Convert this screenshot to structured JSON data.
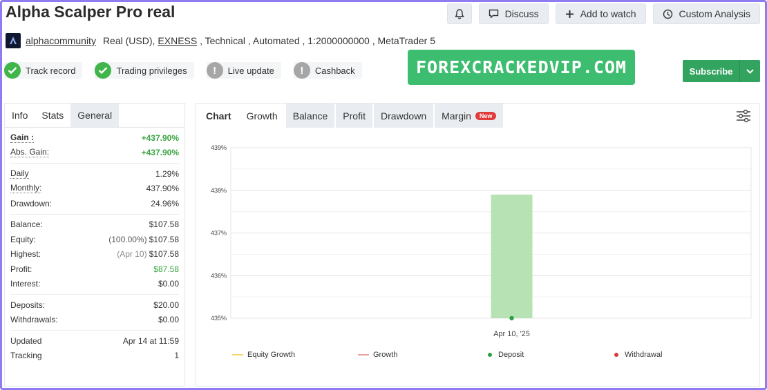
{
  "header": {
    "title": "Alpha Scalper Pro real",
    "actions": {
      "discuss": "Discuss",
      "add_to_watch": "Add to watch",
      "custom_analysis": "Custom Analysis"
    }
  },
  "meta": {
    "author": "alphacommunity",
    "account": "Real (USD),",
    "broker": "EXNESS",
    "details": " , Technical , Automated , 1:2000000000 , MetaTrader 5"
  },
  "badges": [
    {
      "label": "Track record",
      "status": "ok"
    },
    {
      "label": "Trading privileges",
      "status": "ok"
    },
    {
      "label": "Live update",
      "status": "warn"
    },
    {
      "label": "Cashback",
      "status": "warn"
    }
  ],
  "watermark": "FOREXCRACKEDVIP.COM",
  "subscribe": {
    "label": "Subscribe"
  },
  "left_tabs": [
    "Info",
    "Stats",
    "General"
  ],
  "stats": {
    "gain": {
      "label": "Gain :",
      "value": "+437.90%"
    },
    "abs_gain": {
      "label": "Abs. Gain:",
      "value": "+437.90%"
    },
    "daily": {
      "label": "Daily",
      "value": "1.29%"
    },
    "monthly": {
      "label": "Monthly:",
      "value": "437.90%"
    },
    "drawdown": {
      "label": "Drawdown:",
      "value": "24.96%"
    },
    "balance": {
      "label": "Balance:",
      "value": "$107.58"
    },
    "equity": {
      "label": "Equity:",
      "sub": "(100.00%)",
      "value": "$107.58"
    },
    "highest": {
      "label": "Highest:",
      "sub": "(Apr 10)",
      "value": "$107.58"
    },
    "profit": {
      "label": "Profit:",
      "value": "$87.58"
    },
    "interest": {
      "label": "Interest:",
      "value": "$0.00"
    },
    "deposits": {
      "label": "Deposits:",
      "value": "$20.00"
    },
    "withdrawals": {
      "label": "Withdrawals:",
      "value": "$0.00"
    },
    "updated": {
      "label": "Updated",
      "value": "Apr 14 at 11:59"
    },
    "tracking": {
      "label": "Tracking",
      "value": "1"
    }
  },
  "chart_tabs": {
    "chart": "Chart",
    "items": [
      "Growth",
      "Balance",
      "Profit",
      "Drawdown",
      "Margin"
    ],
    "new_badge": "New"
  },
  "legend": {
    "equity_growth": "Equity Growth",
    "growth": "Growth",
    "deposit": "Deposit",
    "withdrawal": "Withdrawal"
  },
  "colors": {
    "equity_growth": "#f5d76e",
    "growth": "#e9a0a0",
    "deposit": "#2ea043",
    "withdrawal": "#d63b3b",
    "bar": "#b7e2b3"
  },
  "chart_data": {
    "type": "bar",
    "categories": [
      "Apr 10, '25"
    ],
    "values": [
      437.9
    ],
    "yticks": [
      "435%",
      "436%",
      "437%",
      "438%",
      "439%"
    ],
    "ylim": [
      435,
      439
    ],
    "deposit_points": [
      {
        "x": "Apr 10, '25",
        "y": 435
      }
    ],
    "grid": true
  }
}
